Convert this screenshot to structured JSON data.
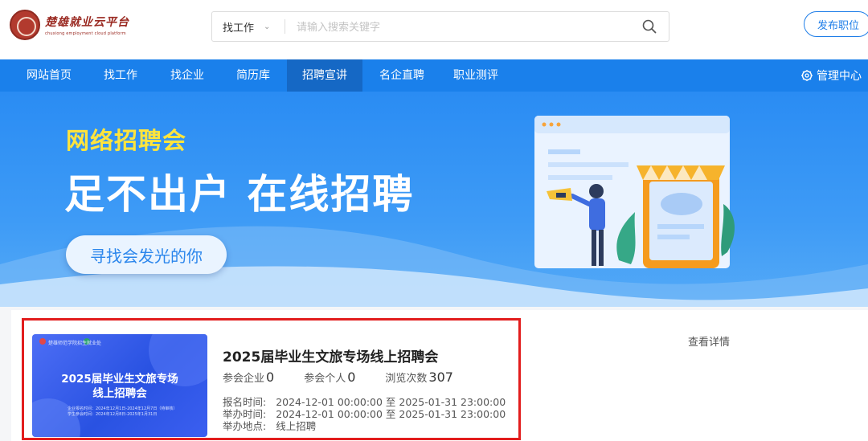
{
  "header": {
    "logo_title": "楚雄就业云平台",
    "logo_subtitle": "chuxiong employment cloud platform",
    "search_type": "找工作",
    "search_placeholder": "请输入搜索关键字",
    "publish_label": "发布职位"
  },
  "nav": {
    "items": [
      "网站首页",
      "找工作",
      "找企业",
      "简历库",
      "招聘宣讲",
      "名企直聘",
      "职业测评"
    ],
    "active_index": 4,
    "admin_label": "管理中心"
  },
  "banner": {
    "tag": "网络招聘会",
    "headline": "足不出户 在线招聘",
    "cta": "寻找会发光的你"
  },
  "event": {
    "thumb_org": "楚雄师范学院招生就业处",
    "thumb_line1": "2025届毕业生文旅专场",
    "thumb_line2": "线上招聘会",
    "thumb_small1": "企业报名时间：2024年12月1日-2024年12月7日（待审核）",
    "thumb_small2": "学生参会时间：2024年12月8日-2025年1月31日",
    "title": "2025届毕业生文旅专场线上招聘会",
    "stats": [
      {
        "label": "参会企业",
        "value": "0"
      },
      {
        "label": "参会个人",
        "value": "0"
      },
      {
        "label": "浏览次数",
        "value": "307"
      }
    ],
    "signup_label": "报名时间:",
    "signup_value": "2024-12-01 00:00:00 至 2025-01-31 23:00:00",
    "hold_label": "举办时间:",
    "hold_value": "2024-12-01 00:00:00 至 2025-01-31 23:00:00",
    "place_label": "举办地点:",
    "place_value": "线上招聘",
    "detail_link": "查看详情"
  },
  "colors": {
    "primary": "#1a80eb",
    "nav_active": "#1568c5",
    "highlight": "#e21d1d",
    "banner_tag": "#ffe43d"
  }
}
